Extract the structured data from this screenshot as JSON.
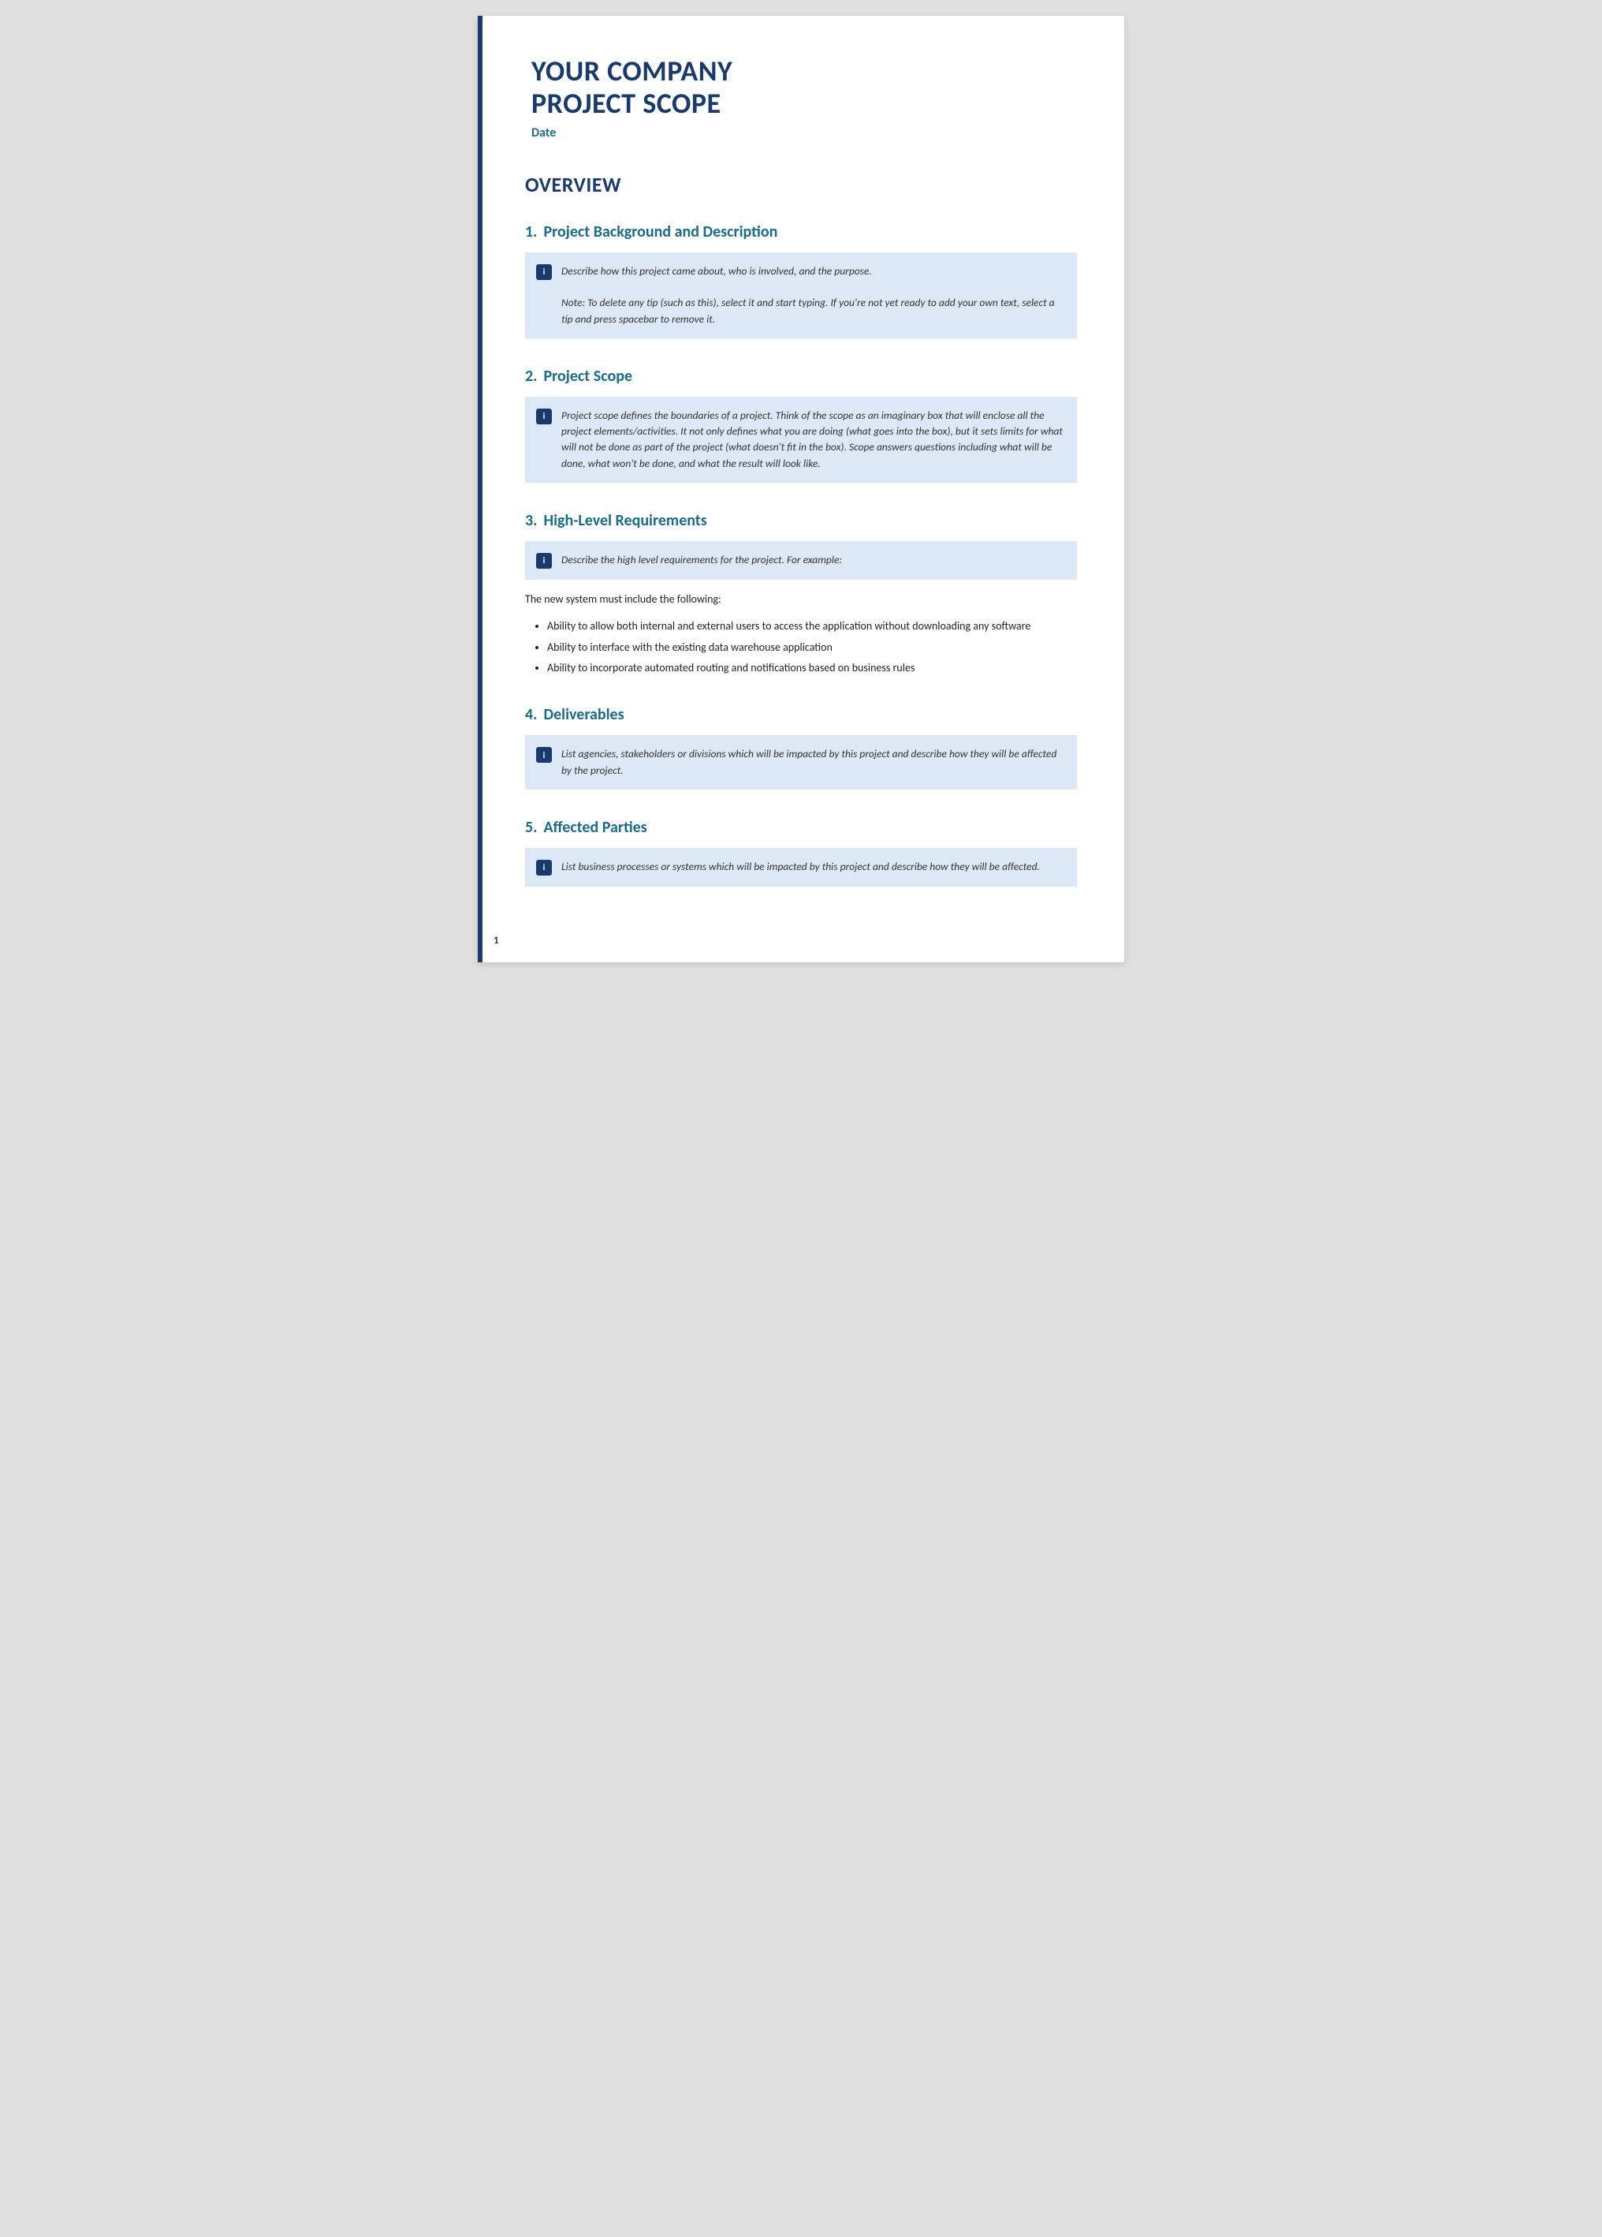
{
  "page": {
    "number": "1"
  },
  "header": {
    "company_line1": "YOUR COMPANY",
    "company_line2": "PROJECT SCOPE",
    "date_label": "Date"
  },
  "overview": {
    "heading": "OVERVIEW"
  },
  "sections": [
    {
      "id": "section-1",
      "number": "1.",
      "title": "Project Background and Description",
      "info_text": "Describe how this project came about, who is involved, and the purpose.\n\nNote: To delete any tip (such as this), select it and start typing. If you're not yet ready to add your own text, select a tip and press spacebar to remove it.",
      "body": null,
      "bullets": null
    },
    {
      "id": "section-2",
      "number": "2.",
      "title": "Project Scope",
      "info_text": "Project scope defines the boundaries of a project. Think of the scope as an imaginary box that will enclose all the project elements/activities. It not only defines what you are doing (what goes into the box), but it sets limits for what will not be done as part of the project (what doesn't fit in the box). Scope answers questions including what will be done, what won't be done, and what the result will look like.",
      "body": null,
      "bullets": null
    },
    {
      "id": "section-3",
      "number": "3.",
      "title": "High-Level Requirements",
      "info_text": "Describe the high level requirements for the project. For example:",
      "body": "The new system must include the following:",
      "bullets": [
        "Ability to allow both internal and external users to access the application without downloading any software",
        "Ability to interface with the existing data warehouse application",
        "Ability to incorporate automated routing and notifications based on business rules"
      ]
    },
    {
      "id": "section-4",
      "number": "4.",
      "title": "Deliverables",
      "info_text": "List agencies, stakeholders or divisions which will be impacted by this project and describe how they will be affected by the project.",
      "body": null,
      "bullets": null
    },
    {
      "id": "section-5",
      "number": "5.",
      "title": "Affected Parties",
      "info_text": "List business processes or systems which will be impacted by this project and describe how they will be affected.",
      "body": null,
      "bullets": null
    }
  ]
}
